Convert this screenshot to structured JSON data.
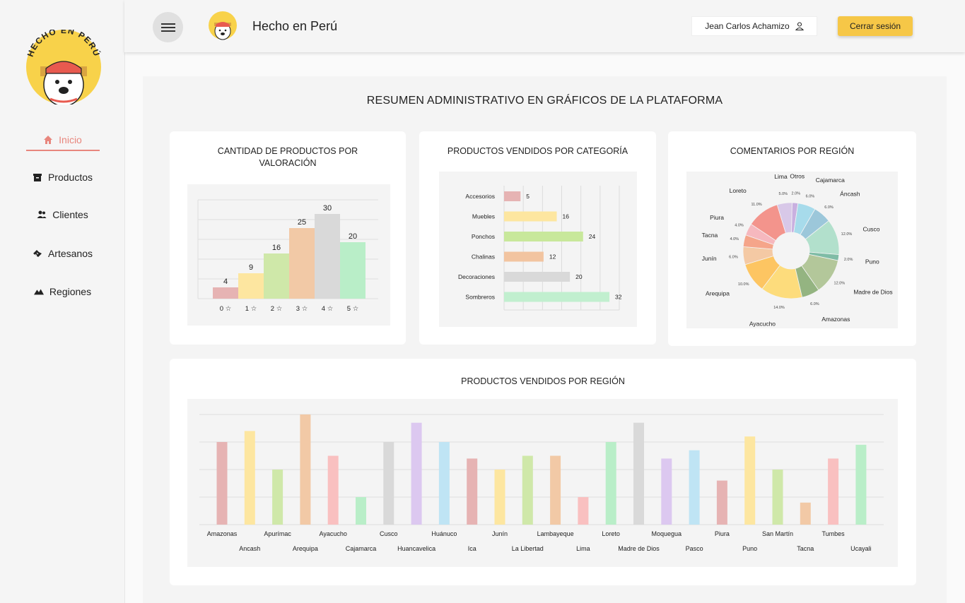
{
  "app": {
    "title": "Hecho en Perú",
    "logo_text": "HECHO EN PERÚ"
  },
  "sidebar": {
    "items": [
      {
        "label": "Inicio",
        "icon": "home-icon",
        "active": true
      },
      {
        "label": "Productos",
        "icon": "archive-icon",
        "active": false
      },
      {
        "label": "Clientes",
        "icon": "people-icon",
        "active": false
      },
      {
        "label": "Artesanos",
        "icon": "handshake-icon",
        "active": false
      },
      {
        "label": "Regiones",
        "icon": "mountain-icon",
        "active": false
      }
    ]
  },
  "header": {
    "menu_icon": "hamburger-icon",
    "user_name": "Jean Carlos Achamizo",
    "user_icon": "user-icon",
    "logout_label": "Cerrar sesión"
  },
  "colors": {
    "accent": "#e8867d",
    "logout_bg": "#f6c747"
  },
  "main": {
    "title": "RESUMEN ADMINISTRATIVO EN GRÁFICOS DE LA PLATAFORMA"
  },
  "chart_data": [
    {
      "type": "bar",
      "title": "CANTIDAD DE PRODUCTOS POR VALORACIÓN",
      "categories": [
        "0 ☆",
        "1 ☆",
        "2 ☆",
        "3 ☆",
        "4 ☆",
        "5 ☆"
      ],
      "values": [
        4,
        9,
        16,
        25,
        30,
        20
      ],
      "colors": [
        "#e6b3b3",
        "#fde6a0",
        "#cfe8a9",
        "#f2c9a6",
        "#d9d9d9",
        "#b9eec8"
      ],
      "ylim": [
        0,
        35
      ],
      "grid": true
    },
    {
      "type": "bar",
      "orientation": "horizontal",
      "title": "PRODUCTOS VENDIDOS POR CATEGORÍA",
      "categories": [
        "Accesorios",
        "Muebles",
        "Ponchos",
        "Chalinas",
        "Decoraciones",
        "Sombreros"
      ],
      "values": [
        5,
        16,
        24,
        12,
        20,
        32
      ],
      "colors": [
        "#e6b3b3",
        "#fde6a0",
        "#c8e89b",
        "#f2c4a0",
        "#d9d9d9",
        "#c1efcf"
      ],
      "xlim": [
        0,
        35
      ],
      "grid": true
    },
    {
      "type": "pie",
      "title": "COMENTARIOS POR REGIÓN",
      "donut": true,
      "slices": [
        {
          "label": "Otros",
          "value": 2.0,
          "display": "2.0%",
          "color": "#c9b0e0"
        },
        {
          "label": "Cajamarca",
          "value": 6.0,
          "display": "6.0%",
          "color": "#a7dbeb"
        },
        {
          "label": "Áncash",
          "value": 6.0,
          "display": "6.0%",
          "color": "#9cc7da"
        },
        {
          "label": "Cusco",
          "value": 12.0,
          "display": "12.0%",
          "color": "#b2e0cc"
        },
        {
          "label": "Puno",
          "value": 2.0,
          "display": "2.0%",
          "color": "#7fbca6"
        },
        {
          "label": "Madre de Dios",
          "value": 12.0,
          "display": "12.0%",
          "color": "#b3c79a"
        },
        {
          "label": "Amazonas",
          "value": 6.0,
          "display": "6.0%",
          "color": "#94b481"
        },
        {
          "label": "Ayacucho",
          "value": 14.0,
          "display": "14.0%",
          "color": "#fddc7c"
        },
        {
          "label": "Arequipa",
          "value": 10.0,
          "display": "10.0%",
          "color": "#fdc562"
        },
        {
          "label": "Junín",
          "value": 6.0,
          "display": "6.0%",
          "color": "#f4c9a4"
        },
        {
          "label": "Tacna",
          "value": 4.0,
          "display": "4.0%",
          "color": "#f5a58a"
        },
        {
          "label": "Piura",
          "value": 4.0,
          "display": "4.0%",
          "color": "#f6b8be"
        },
        {
          "label": "Loreto",
          "value": 11.0,
          "display": "11.0%",
          "color": "#f3948c"
        },
        {
          "label": "Lima",
          "value": 5.0,
          "display": "5.0%",
          "color": "#d8c8e8"
        }
      ]
    },
    {
      "type": "bar",
      "title": "PRODUCTOS VENDIDOS POR REGIÓN",
      "categories": [
        "Amazonas",
        "Ancash",
        "Apurímac",
        "Arequipa",
        "Ayacucho",
        "Cajamarca",
        "Cusco",
        "Huancavelica",
        "Huánuco",
        "Ica",
        "Junín",
        "La Libertad",
        "Lambayeque",
        "Lima",
        "Loreto",
        "Madre de Dios",
        "Moquegua",
        "Pasco",
        "Piura",
        "Puno",
        "San Martín",
        "Tacna",
        "Tumbes",
        "Ucayali"
      ],
      "values": [
        30,
        34,
        20,
        40,
        25,
        10,
        30,
        37,
        30,
        24,
        20,
        25,
        25,
        10,
        30,
        37,
        24,
        27,
        16,
        32,
        20,
        8,
        24,
        29
      ],
      "colors": [
        "#e6b3b3",
        "#fde6a0",
        "#cfe8a9",
        "#f2c9a6",
        "#f9c0c0",
        "#b9eec8",
        "#d9d9d9",
        "#dcc8f0",
        "#bfe4f4",
        "#e6b3b3",
        "#fde6a0",
        "#cfe8a9",
        "#f2c9a6",
        "#f9c0c0",
        "#b9eec8",
        "#d9d9d9",
        "#dcc8f0",
        "#bfe4f4",
        "#e6b3b3",
        "#fde6a0",
        "#cfe8a9",
        "#f2c9a6",
        "#f9c0c0",
        "#b9eec8"
      ],
      "ylim": [
        0,
        40
      ],
      "grid": true
    }
  ]
}
